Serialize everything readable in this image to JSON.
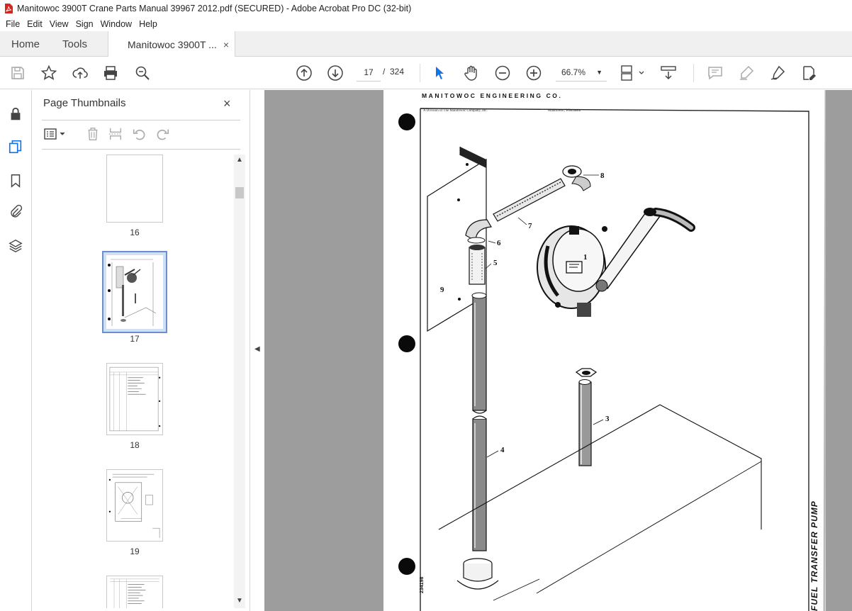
{
  "window": {
    "title": "Manitowoc 3900T Crane Parts Manual 39967 2012.pdf (SECURED) - Adobe Acrobat Pro DC (32-bit)"
  },
  "menu": [
    "File",
    "Edit",
    "View",
    "Sign",
    "Window",
    "Help"
  ],
  "tabs": {
    "home": "Home",
    "tools": "Tools",
    "doc": "Manitowoc 3900T ...",
    "close": "×"
  },
  "toolbar": {
    "current_page": "17",
    "separator": "/",
    "total_pages": "324",
    "zoom": "66.7%"
  },
  "panel": {
    "title": "Page Thumbnails",
    "close": "×",
    "thumbnails": [
      {
        "label": "16"
      },
      {
        "label": "17",
        "selected": true
      },
      {
        "label": "18"
      },
      {
        "label": "19"
      }
    ]
  },
  "page": {
    "header": "MANITOWOC ENGINEERING CO.",
    "subheader_left": "A Division of The Manitowoc Company, Inc.",
    "subheader_right": "Manitowoc, Wisconsin",
    "side_title": "FUEL TRANSFER PUMP",
    "drawing_no": "234198",
    "callouts": [
      "1",
      "3",
      "4",
      "5",
      "6",
      "7",
      "8",
      "9"
    ]
  },
  "colors": {
    "accent": "#1473e6",
    "selection": "#cfe0f5",
    "canvas": "#9d9d9d"
  }
}
